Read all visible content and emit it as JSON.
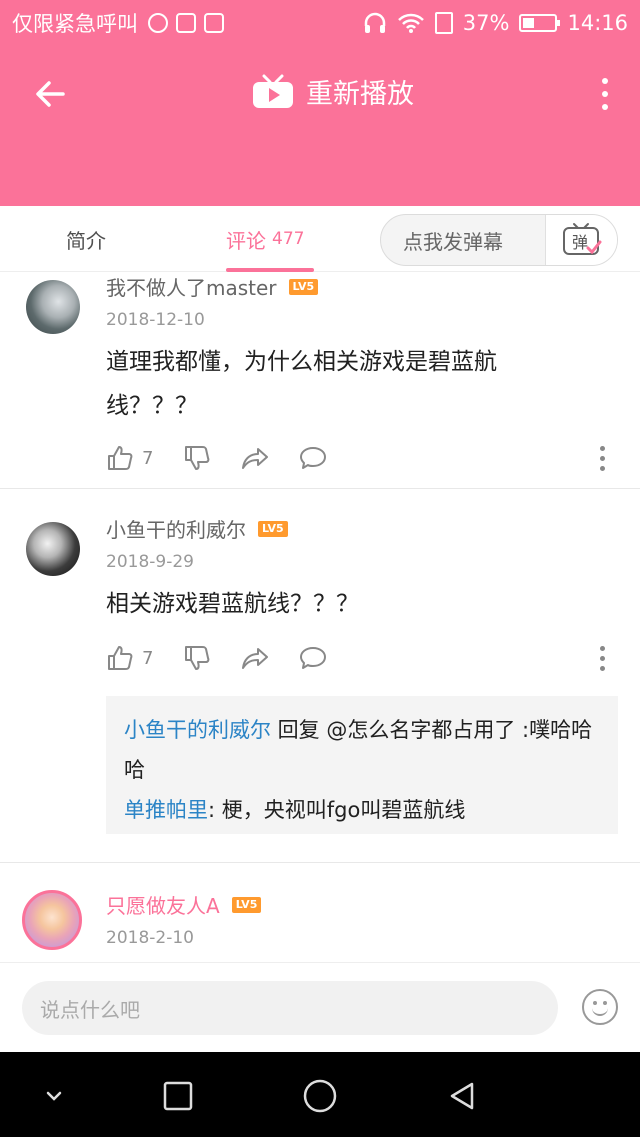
{
  "status_bar": {
    "carrier_text": "仅限紧急呼叫",
    "battery_percent": "37%",
    "battery_level": 0.37,
    "time": "14:16"
  },
  "appbar": {
    "title": "重新播放"
  },
  "tabs": {
    "intro_label": "简介",
    "comments_label": "评论",
    "comments_count": "477",
    "danmaku_placeholder": "点我发弹幕",
    "danmaku_icon_text": "弹"
  },
  "comments": [
    {
      "username": "我不做人了master",
      "level": "LV5",
      "date": "2018-12-10",
      "text": "道理我都懂，为什么相关游戏是碧蓝航线？？？",
      "likes": "7"
    },
    {
      "username": "小鱼干的利威尔",
      "level": "LV5",
      "date": "2018-9-29",
      "text": "相关游戏碧蓝航线？？？",
      "likes": "7",
      "replies": [
        {
          "author": "小鱼干的利威尔",
          "text": " 回复 @怎么名字都占用了 :噗哈哈哈"
        },
        {
          "author": "单推帕里",
          "text": ": 梗，央视叫fgo叫碧蓝航线"
        }
      ]
    },
    {
      "username": "只愿做友人A",
      "level": "LV5",
      "date": "2018-2-10"
    }
  ],
  "input": {
    "placeholder": "说点什么吧"
  },
  "colors": {
    "brand_pink": "#fb7299",
    "level_badge": "#ff9a2e",
    "reply_link": "#2b84c6"
  },
  "icons": {
    "back": "arrow-left-icon",
    "tv": "tv-icon",
    "more": "more-vertical-icon",
    "like": "thumb-up-icon",
    "dislike": "thumb-down-icon",
    "share": "share-icon",
    "reply": "chat-bubble-icon",
    "emoji": "emoji-icon"
  }
}
